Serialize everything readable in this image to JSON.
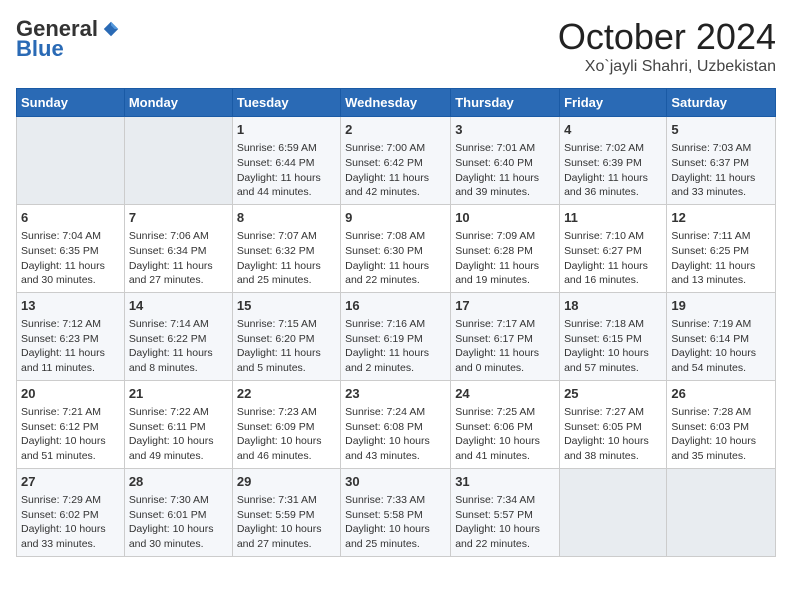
{
  "logo": {
    "general": "General",
    "blue": "Blue"
  },
  "title": "October 2024",
  "subtitle": "Xo`jayli Shahri, Uzbekistan",
  "days_of_week": [
    "Sunday",
    "Monday",
    "Tuesday",
    "Wednesday",
    "Thursday",
    "Friday",
    "Saturday"
  ],
  "weeks": [
    [
      {
        "day": "",
        "content": ""
      },
      {
        "day": "",
        "content": ""
      },
      {
        "day": "1",
        "content": "Sunrise: 6:59 AM\nSunset: 6:44 PM\nDaylight: 11 hours and 44 minutes."
      },
      {
        "day": "2",
        "content": "Sunrise: 7:00 AM\nSunset: 6:42 PM\nDaylight: 11 hours and 42 minutes."
      },
      {
        "day": "3",
        "content": "Sunrise: 7:01 AM\nSunset: 6:40 PM\nDaylight: 11 hours and 39 minutes."
      },
      {
        "day": "4",
        "content": "Sunrise: 7:02 AM\nSunset: 6:39 PM\nDaylight: 11 hours and 36 minutes."
      },
      {
        "day": "5",
        "content": "Sunrise: 7:03 AM\nSunset: 6:37 PM\nDaylight: 11 hours and 33 minutes."
      }
    ],
    [
      {
        "day": "6",
        "content": "Sunrise: 7:04 AM\nSunset: 6:35 PM\nDaylight: 11 hours and 30 minutes."
      },
      {
        "day": "7",
        "content": "Sunrise: 7:06 AM\nSunset: 6:34 PM\nDaylight: 11 hours and 27 minutes."
      },
      {
        "day": "8",
        "content": "Sunrise: 7:07 AM\nSunset: 6:32 PM\nDaylight: 11 hours and 25 minutes."
      },
      {
        "day": "9",
        "content": "Sunrise: 7:08 AM\nSunset: 6:30 PM\nDaylight: 11 hours and 22 minutes."
      },
      {
        "day": "10",
        "content": "Sunrise: 7:09 AM\nSunset: 6:28 PM\nDaylight: 11 hours and 19 minutes."
      },
      {
        "day": "11",
        "content": "Sunrise: 7:10 AM\nSunset: 6:27 PM\nDaylight: 11 hours and 16 minutes."
      },
      {
        "day": "12",
        "content": "Sunrise: 7:11 AM\nSunset: 6:25 PM\nDaylight: 11 hours and 13 minutes."
      }
    ],
    [
      {
        "day": "13",
        "content": "Sunrise: 7:12 AM\nSunset: 6:23 PM\nDaylight: 11 hours and 11 minutes."
      },
      {
        "day": "14",
        "content": "Sunrise: 7:14 AM\nSunset: 6:22 PM\nDaylight: 11 hours and 8 minutes."
      },
      {
        "day": "15",
        "content": "Sunrise: 7:15 AM\nSunset: 6:20 PM\nDaylight: 11 hours and 5 minutes."
      },
      {
        "day": "16",
        "content": "Sunrise: 7:16 AM\nSunset: 6:19 PM\nDaylight: 11 hours and 2 minutes."
      },
      {
        "day": "17",
        "content": "Sunrise: 7:17 AM\nSunset: 6:17 PM\nDaylight: 11 hours and 0 minutes."
      },
      {
        "day": "18",
        "content": "Sunrise: 7:18 AM\nSunset: 6:15 PM\nDaylight: 10 hours and 57 minutes."
      },
      {
        "day": "19",
        "content": "Sunrise: 7:19 AM\nSunset: 6:14 PM\nDaylight: 10 hours and 54 minutes."
      }
    ],
    [
      {
        "day": "20",
        "content": "Sunrise: 7:21 AM\nSunset: 6:12 PM\nDaylight: 10 hours and 51 minutes."
      },
      {
        "day": "21",
        "content": "Sunrise: 7:22 AM\nSunset: 6:11 PM\nDaylight: 10 hours and 49 minutes."
      },
      {
        "day": "22",
        "content": "Sunrise: 7:23 AM\nSunset: 6:09 PM\nDaylight: 10 hours and 46 minutes."
      },
      {
        "day": "23",
        "content": "Sunrise: 7:24 AM\nSunset: 6:08 PM\nDaylight: 10 hours and 43 minutes."
      },
      {
        "day": "24",
        "content": "Sunrise: 7:25 AM\nSunset: 6:06 PM\nDaylight: 10 hours and 41 minutes."
      },
      {
        "day": "25",
        "content": "Sunrise: 7:27 AM\nSunset: 6:05 PM\nDaylight: 10 hours and 38 minutes."
      },
      {
        "day": "26",
        "content": "Sunrise: 7:28 AM\nSunset: 6:03 PM\nDaylight: 10 hours and 35 minutes."
      }
    ],
    [
      {
        "day": "27",
        "content": "Sunrise: 7:29 AM\nSunset: 6:02 PM\nDaylight: 10 hours and 33 minutes."
      },
      {
        "day": "28",
        "content": "Sunrise: 7:30 AM\nSunset: 6:01 PM\nDaylight: 10 hours and 30 minutes."
      },
      {
        "day": "29",
        "content": "Sunrise: 7:31 AM\nSunset: 5:59 PM\nDaylight: 10 hours and 27 minutes."
      },
      {
        "day": "30",
        "content": "Sunrise: 7:33 AM\nSunset: 5:58 PM\nDaylight: 10 hours and 25 minutes."
      },
      {
        "day": "31",
        "content": "Sunrise: 7:34 AM\nSunset: 5:57 PM\nDaylight: 10 hours and 22 minutes."
      },
      {
        "day": "",
        "content": ""
      },
      {
        "day": "",
        "content": ""
      }
    ]
  ]
}
